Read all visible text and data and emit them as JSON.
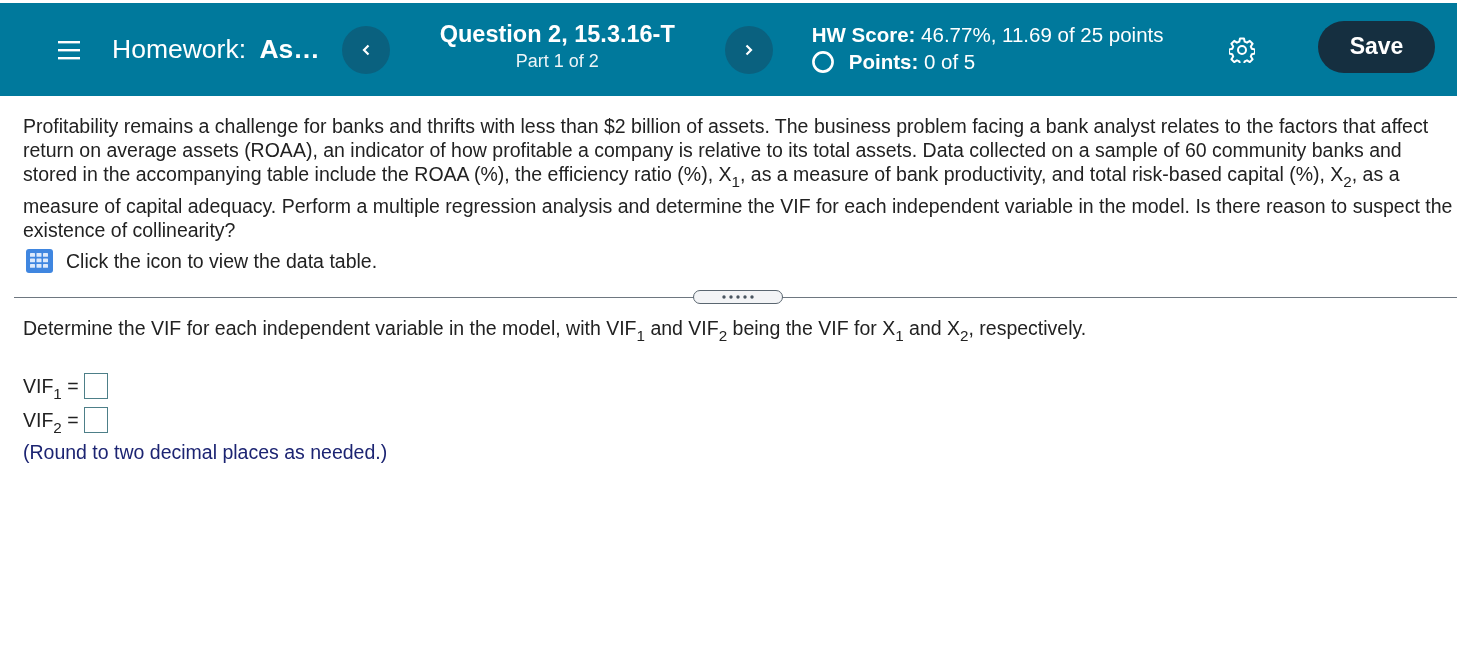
{
  "header": {
    "title": "Homework: **As…**",
    "question": "Question 2, 15.3.16-T",
    "part": "Part 1 of 2",
    "score": "**HW Score:** 46.77%, 11.69 of 25 points",
    "points": "**Points:** 0 of 5",
    "save": "Save"
  },
  "question_text": "Profitability remains a challenge for banks and thrifts with less than $2 billion of assets. The business problem facing a bank analyst relates to the factors that affect return on average assets (ROAA), an indicator of how profitable a company is relative to its total assets. Data collected on a sample of 60 community banks and stored in the accompanying table include the ROAA (%), the efficiency ratio (%), X$_{1}$, as a measure of bank productivity, and total risk-based capital (%), X$_{2}$, as a measure of capital adequacy. Perform a multiple regression analysis and determine the VIF for each independent variable in the model. Is there reason to suspect the existence of collinearity?",
  "data_table_hint": "Click the icon to view the data table.",
  "prompt": "Determine the VIF for each independent variable in the model, with VIF$_{1}$ and VIF$_{2}$ being the VIF for X$_{1}$ and X$_{2}$, respectively.",
  "answers": [
    {
      "label": "VIF$_{1}$ ="
    },
    {
      "label": "VIF$_{2}$ ="
    }
  ],
  "note": "(Round to two decimal places as needed.)"
}
